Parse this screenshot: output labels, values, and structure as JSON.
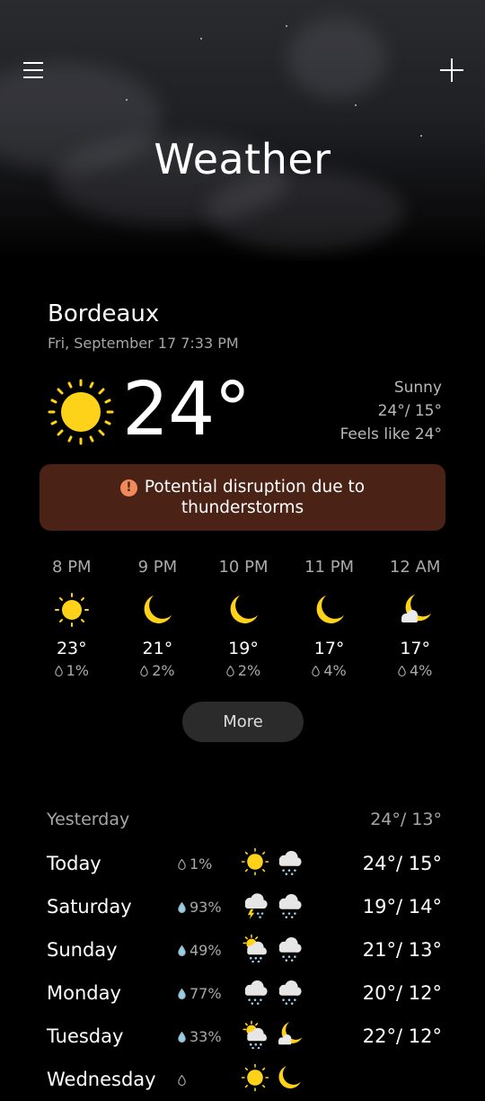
{
  "header": {
    "title": "Weather",
    "menu_icon": "menu-icon",
    "add_icon": "plus-icon"
  },
  "location": {
    "city": "Bordeaux",
    "datetime": "Fri, September 17 7:33 PM"
  },
  "current": {
    "temp": "24°",
    "condition": "Sunny",
    "high_low": "24°/ 15°",
    "feels_like": "Feels like 24°",
    "icon": "sun-icon"
  },
  "alert": {
    "text": "Potential disruption due to thunderstorms",
    "icon": "warning-icon"
  },
  "hourly": [
    {
      "time": "8 PM",
      "icon": "sun-icon",
      "temp": "23°",
      "precip": "1%"
    },
    {
      "time": "9 PM",
      "icon": "moon-icon",
      "temp": "21°",
      "precip": "2%"
    },
    {
      "time": "10 PM",
      "icon": "moon-icon",
      "temp": "19°",
      "precip": "2%"
    },
    {
      "time": "11 PM",
      "icon": "moon-icon",
      "temp": "17°",
      "precip": "4%"
    },
    {
      "time": "12 AM",
      "icon": "moon-cloud-icon",
      "temp": "17°",
      "precip": "4%"
    }
  ],
  "more_label": "More",
  "yesterday": {
    "label": "Yesterday",
    "temps": "24°/ 13°"
  },
  "daily": [
    {
      "day": "Today",
      "precip": "1%",
      "temps": "24°/ 15°",
      "icon_day": "sun-icon",
      "icon_night": "rain-cloud-icon"
    },
    {
      "day": "Saturday",
      "precip": "93%",
      "temps": "19°/ 14°",
      "icon_day": "thunderstorm-icon",
      "icon_night": "rain-cloud-icon"
    },
    {
      "day": "Sunday",
      "precip": "49%",
      "temps": "21°/ 13°",
      "icon_day": "sun-rain-icon",
      "icon_night": "rain-cloud-icon"
    },
    {
      "day": "Monday",
      "precip": "77%",
      "temps": "20°/ 12°",
      "icon_day": "rain-cloud-icon",
      "icon_night": "rain-cloud-icon"
    },
    {
      "day": "Tuesday",
      "precip": "33%",
      "temps": "22°/ 12°",
      "icon_day": "sun-rain-icon",
      "icon_night": "moon-cloud-icon"
    },
    {
      "day": "Wednesday",
      "precip": "",
      "temps": "",
      "icon_day": "sun-icon",
      "icon_night": "moon-icon"
    }
  ],
  "colors": {
    "background": "#000000",
    "alert_bg": "#4b2216",
    "sun": "#ffd21a",
    "muted_text": "#a9a9a9"
  }
}
